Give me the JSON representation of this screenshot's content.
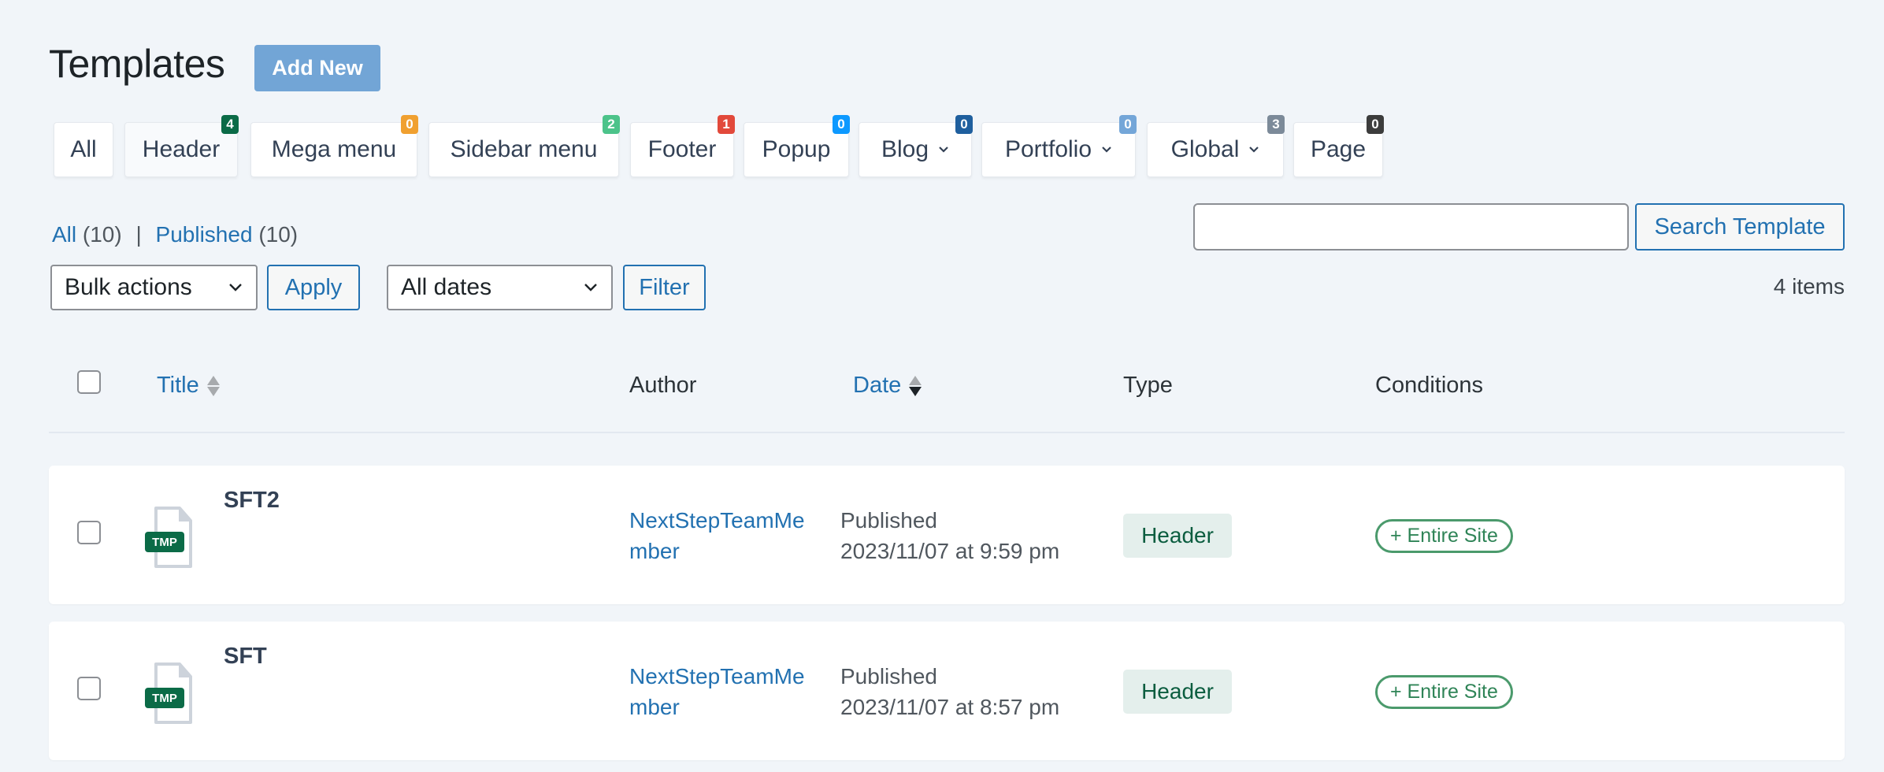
{
  "header": {
    "title": "Templates",
    "add_new_label": "Add New"
  },
  "tabs": [
    {
      "label": "All",
      "badge": null,
      "badge_color": null,
      "dropdown": false
    },
    {
      "label": "Header",
      "badge": "4",
      "badge_color": "#0b6b47",
      "dropdown": false
    },
    {
      "label": "Mega menu",
      "badge": "0",
      "badge_color": "#f0a030",
      "dropdown": false
    },
    {
      "label": "Sidebar menu",
      "badge": "2",
      "badge_color": "#4cc38a",
      "dropdown": false
    },
    {
      "label": "Footer",
      "badge": "1",
      "badge_color": "#e2493b",
      "dropdown": false
    },
    {
      "label": "Popup",
      "badge": "0",
      "badge_color": "#0d99ff",
      "dropdown": false
    },
    {
      "label": "Blog",
      "badge": "0",
      "badge_color": "#1f5f9e",
      "dropdown": true
    },
    {
      "label": "Portfolio",
      "badge": "0",
      "badge_color": "#74a6d8",
      "dropdown": true
    },
    {
      "label": "Global",
      "badge": "3",
      "badge_color": "#7c8a99",
      "dropdown": true
    },
    {
      "label": "Page",
      "badge": "0",
      "badge_color": "#3c3c3c",
      "dropdown": false
    }
  ],
  "views": {
    "all_label": "All",
    "all_count": "(10)",
    "separator": "|",
    "published_label": "Published",
    "published_count": "(10)"
  },
  "search": {
    "value": "",
    "placeholder": "",
    "button_label": "Search Template"
  },
  "toolbar": {
    "bulk_actions": "Bulk actions",
    "apply_label": "Apply",
    "dates": "All dates",
    "filter_label": "Filter",
    "items_count": "4 items"
  },
  "table": {
    "columns": {
      "title": "Title",
      "author": "Author",
      "date": "Date",
      "type": "Type",
      "conditions": "Conditions"
    },
    "rows": [
      {
        "title": "SFT2",
        "icon_label": "TMP",
        "author": "NextStepTeamMember",
        "status": "Published",
        "date": "2023/11/07 at 9:59 pm",
        "type": "Header",
        "condition": "+ Entire Site"
      },
      {
        "title": "SFT",
        "icon_label": "TMP",
        "author": "NextStepTeamMember",
        "status": "Published",
        "date": "2023/11/07 at 8:57 pm",
        "type": "Header",
        "condition": "+ Entire Site"
      }
    ]
  }
}
